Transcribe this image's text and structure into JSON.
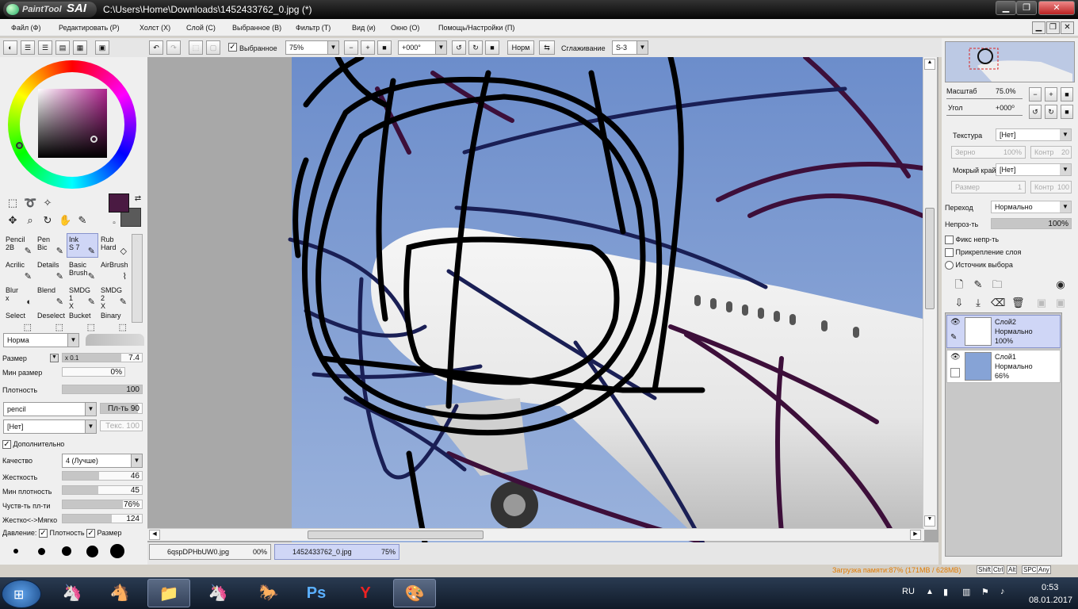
{
  "window": {
    "app_logo_prefix": "PaintTool",
    "app_logo_name": "SAI",
    "title": "C:\\Users\\Home\\Downloads\\1452433762_0.jpg (*)"
  },
  "menu": [
    "Файл (Ф)",
    "Редактировать (Р)",
    "Холст (X)",
    "Слой (С)",
    "Выбранное (В)",
    "Фильтр (Т)",
    "Вид (и)",
    "Окно (О)",
    "Помощь/Настройки (П)"
  ],
  "toolbar": {
    "selection_label": "Выбранное",
    "zoom": "75%",
    "rotation": "+000°",
    "mode": "Норм",
    "smoothing_label": "Сглаживание",
    "smoothing_value": "S-3"
  },
  "colors": {
    "primary": "#4a1a42",
    "secondary": "#5a5a5a",
    "accent_selected": "#cfd6f6"
  },
  "tools": [
    {
      "l1": "Pencil",
      "l2": "2B"
    },
    {
      "l1": "Pen",
      "l2": "Bic"
    },
    {
      "l1": "Ink",
      "l2": "S 7"
    },
    {
      "l1": "Rub",
      "l2": "Hard"
    },
    {
      "l1": "Acrilic",
      "l2": ""
    },
    {
      "l1": "Details",
      "l2": ""
    },
    {
      "l1": "Basic",
      "l2": "Brush"
    },
    {
      "l1": "AirBrush",
      "l2": ""
    },
    {
      "l1": "Blur",
      "l2": "x"
    },
    {
      "l1": "Blend",
      "l2": ""
    },
    {
      "l1": "SMDG 1",
      "l2": "X"
    },
    {
      "l1": "SMDG 2",
      "l2": "X"
    },
    {
      "l1": "Select",
      "l2": ""
    },
    {
      "l1": "Deselect",
      "l2": ""
    },
    {
      "l1": "Bucket",
      "l2": ""
    },
    {
      "l1": "Binary",
      "l2": ""
    }
  ],
  "brush": {
    "blend_mode": "Норма",
    "size_label": "Размер",
    "size_mult": "x 0.1",
    "size_value": "7.4",
    "min_size_label": "Мин размер",
    "min_size_value": "0%",
    "density_label": "Плотность",
    "density_value": "100",
    "shape": "pencil",
    "shape_strength": "Пл-ть 90",
    "texture": "[Нет]",
    "texture_strength": "Текс. 100",
    "advanced_label": "Дополнительно",
    "quality_label": "Качество",
    "quality_value": "4 (Лучше)",
    "hardness_label": "Жесткость",
    "hardness_value": "46",
    "min_density_label": "Мин плотность",
    "min_density_value": "45",
    "sensitivity_label": "Чуств-ть пл-ти",
    "sensitivity_value": "76%",
    "softness_label": "Жестко<->Мягко",
    "softness_value": "124",
    "pressure_label": "Давление:",
    "pressure_density": "Плотность",
    "pressure_size": "Размер"
  },
  "nav": {
    "scale_label": "Масштаб",
    "scale_value": "75.0%",
    "angle_label": "Угол",
    "angle_value": "+000⁰"
  },
  "paper": {
    "texture_label": "Текстура",
    "texture_value": "[Нет]",
    "grain_label": "Зерно",
    "grain_value": "100%",
    "contrast_label": "Контр",
    "contrast_value": "20",
    "wet_label": "Мокрый край",
    "wet_value": "[Нет]",
    "size_label": "Размер",
    "size_value": "1",
    "wet_contrast_label": "Контр",
    "wet_contrast_value": "100"
  },
  "layer_props": {
    "blend_label": "Переход",
    "blend_value": "Нормально",
    "opacity_label": "Непроз-ть",
    "opacity_value": "100%",
    "opacity": 1.0,
    "preserve_label": "Фикс непр-ть",
    "clip_label": "Прикрепление слоя",
    "source_label": "Источник выбора"
  },
  "layers": [
    {
      "name": "Слой2",
      "mode": "Нормально",
      "opacity": "100%"
    },
    {
      "name": "Слой1",
      "mode": "Нормально",
      "opacity": "66%"
    }
  ],
  "documents": [
    {
      "name": "6qspDPHbUW0.jpg",
      "zoom": "00%"
    },
    {
      "name": "1452433762_0.jpg",
      "zoom": "75%"
    }
  ],
  "status": {
    "memory": "Загрузка памяти:87% (171MB / 628MB)",
    "keys": [
      "Shift",
      "Ctrl",
      "Alt",
      "SPC",
      "Any"
    ]
  },
  "taskbar": {
    "lang": "RU",
    "time": "0:53",
    "date": "08.01.2017"
  }
}
